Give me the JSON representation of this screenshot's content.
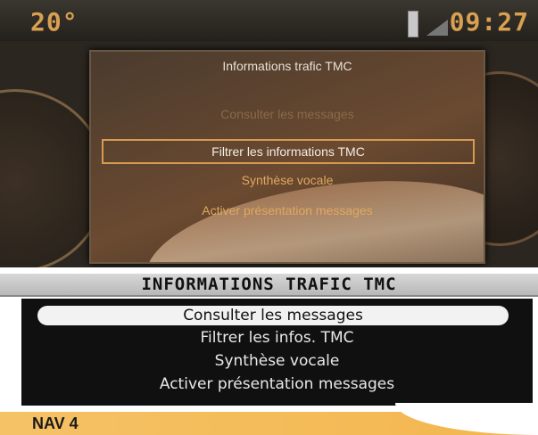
{
  "status": {
    "temperature": "20°",
    "time": "09:27"
  },
  "panel": {
    "title": "Informations trafic TMC",
    "options": [
      "Consulter les messages",
      "Filtrer les informations TMC",
      "Synthèse vocale",
      "Activer présentation messages"
    ]
  },
  "menu": {
    "title": "INFORMATIONS TRAFIC TMC",
    "items": [
      "Consulter les messages",
      "Filtrer les infos. TMC",
      "Synthèse vocale",
      "Activer présentation messages"
    ]
  },
  "footer": {
    "label": "NAV 4"
  },
  "colors": {
    "accent": "#f3b64e",
    "amber_text": "#d8a050",
    "highlight": "#d69a50"
  },
  "icons": {
    "signal": "signal-strength-icon",
    "antenna": "antenna-icon"
  }
}
